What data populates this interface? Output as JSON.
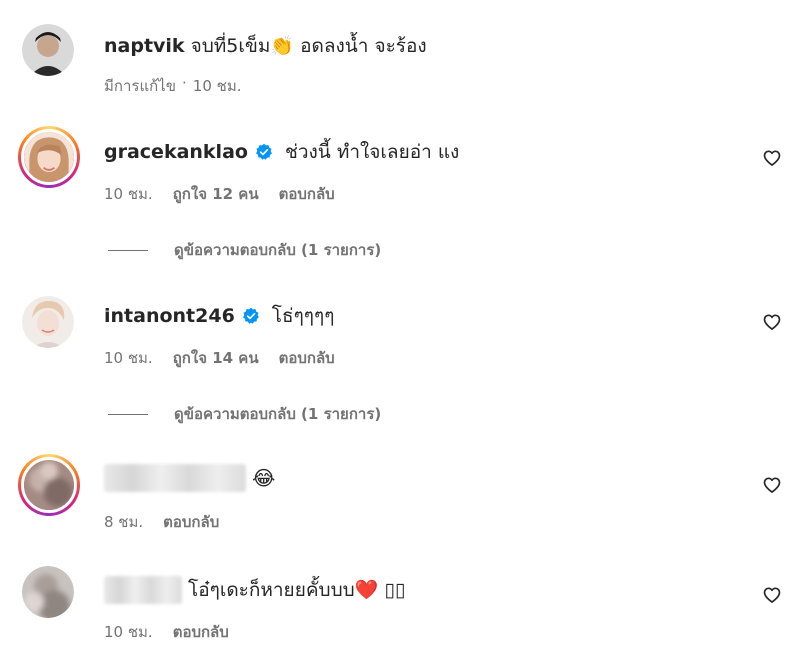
{
  "comments": [
    {
      "username": "naptvik",
      "text": "จบที่5เข็ม👏 อดลงน้ำ จะร้อง",
      "edited": "มีการแก้ไข",
      "sep": "·",
      "time": "10 ชม.",
      "verified": false,
      "story_ring": false,
      "avatar_color": "#3a3a3a"
    },
    {
      "username": "gracekanklao",
      "text": "ช่วงนี้ ทำใจเลยอ่า แง",
      "time": "10 ชม.",
      "likes": "ถูกใจ 12 คน",
      "reply": "ตอบกลับ",
      "view_replies": "ดูข้อความตอบกลับ (1 รายการ)",
      "verified": true,
      "story_ring": true,
      "avatar_color": "#e9c9b5"
    },
    {
      "username": "intanont246",
      "text": "โธ่ๆๆๆๆ",
      "time": "10 ชม.",
      "likes": "ถูกใจ 14 คน",
      "reply": "ตอบกลับ",
      "view_replies": "ดูข้อความตอบกลับ (1 รายการ)",
      "verified": true,
      "story_ring": false,
      "avatar_color": "#e6d8d2"
    },
    {
      "username": "",
      "text": "😂",
      "time": "8 ชม.",
      "reply": "ตอบกลับ",
      "verified": false,
      "story_ring": true,
      "avatar_color": "#b49a93"
    },
    {
      "username": "",
      "text": "โอ๋ๆเดะก็หายยคั้บบบ❤️ ▯▯",
      "time": "10 ชม.",
      "reply": "ตอบกลับ",
      "verified": false,
      "story_ring": false,
      "avatar_color": "#b9b3b0"
    }
  ],
  "icons": {
    "heart": "heart-outline-icon",
    "verified": "verified-badge-icon"
  },
  "colors": {
    "verified": "#0095f6",
    "meta_text": "#737373",
    "primary_text": "#262626"
  }
}
